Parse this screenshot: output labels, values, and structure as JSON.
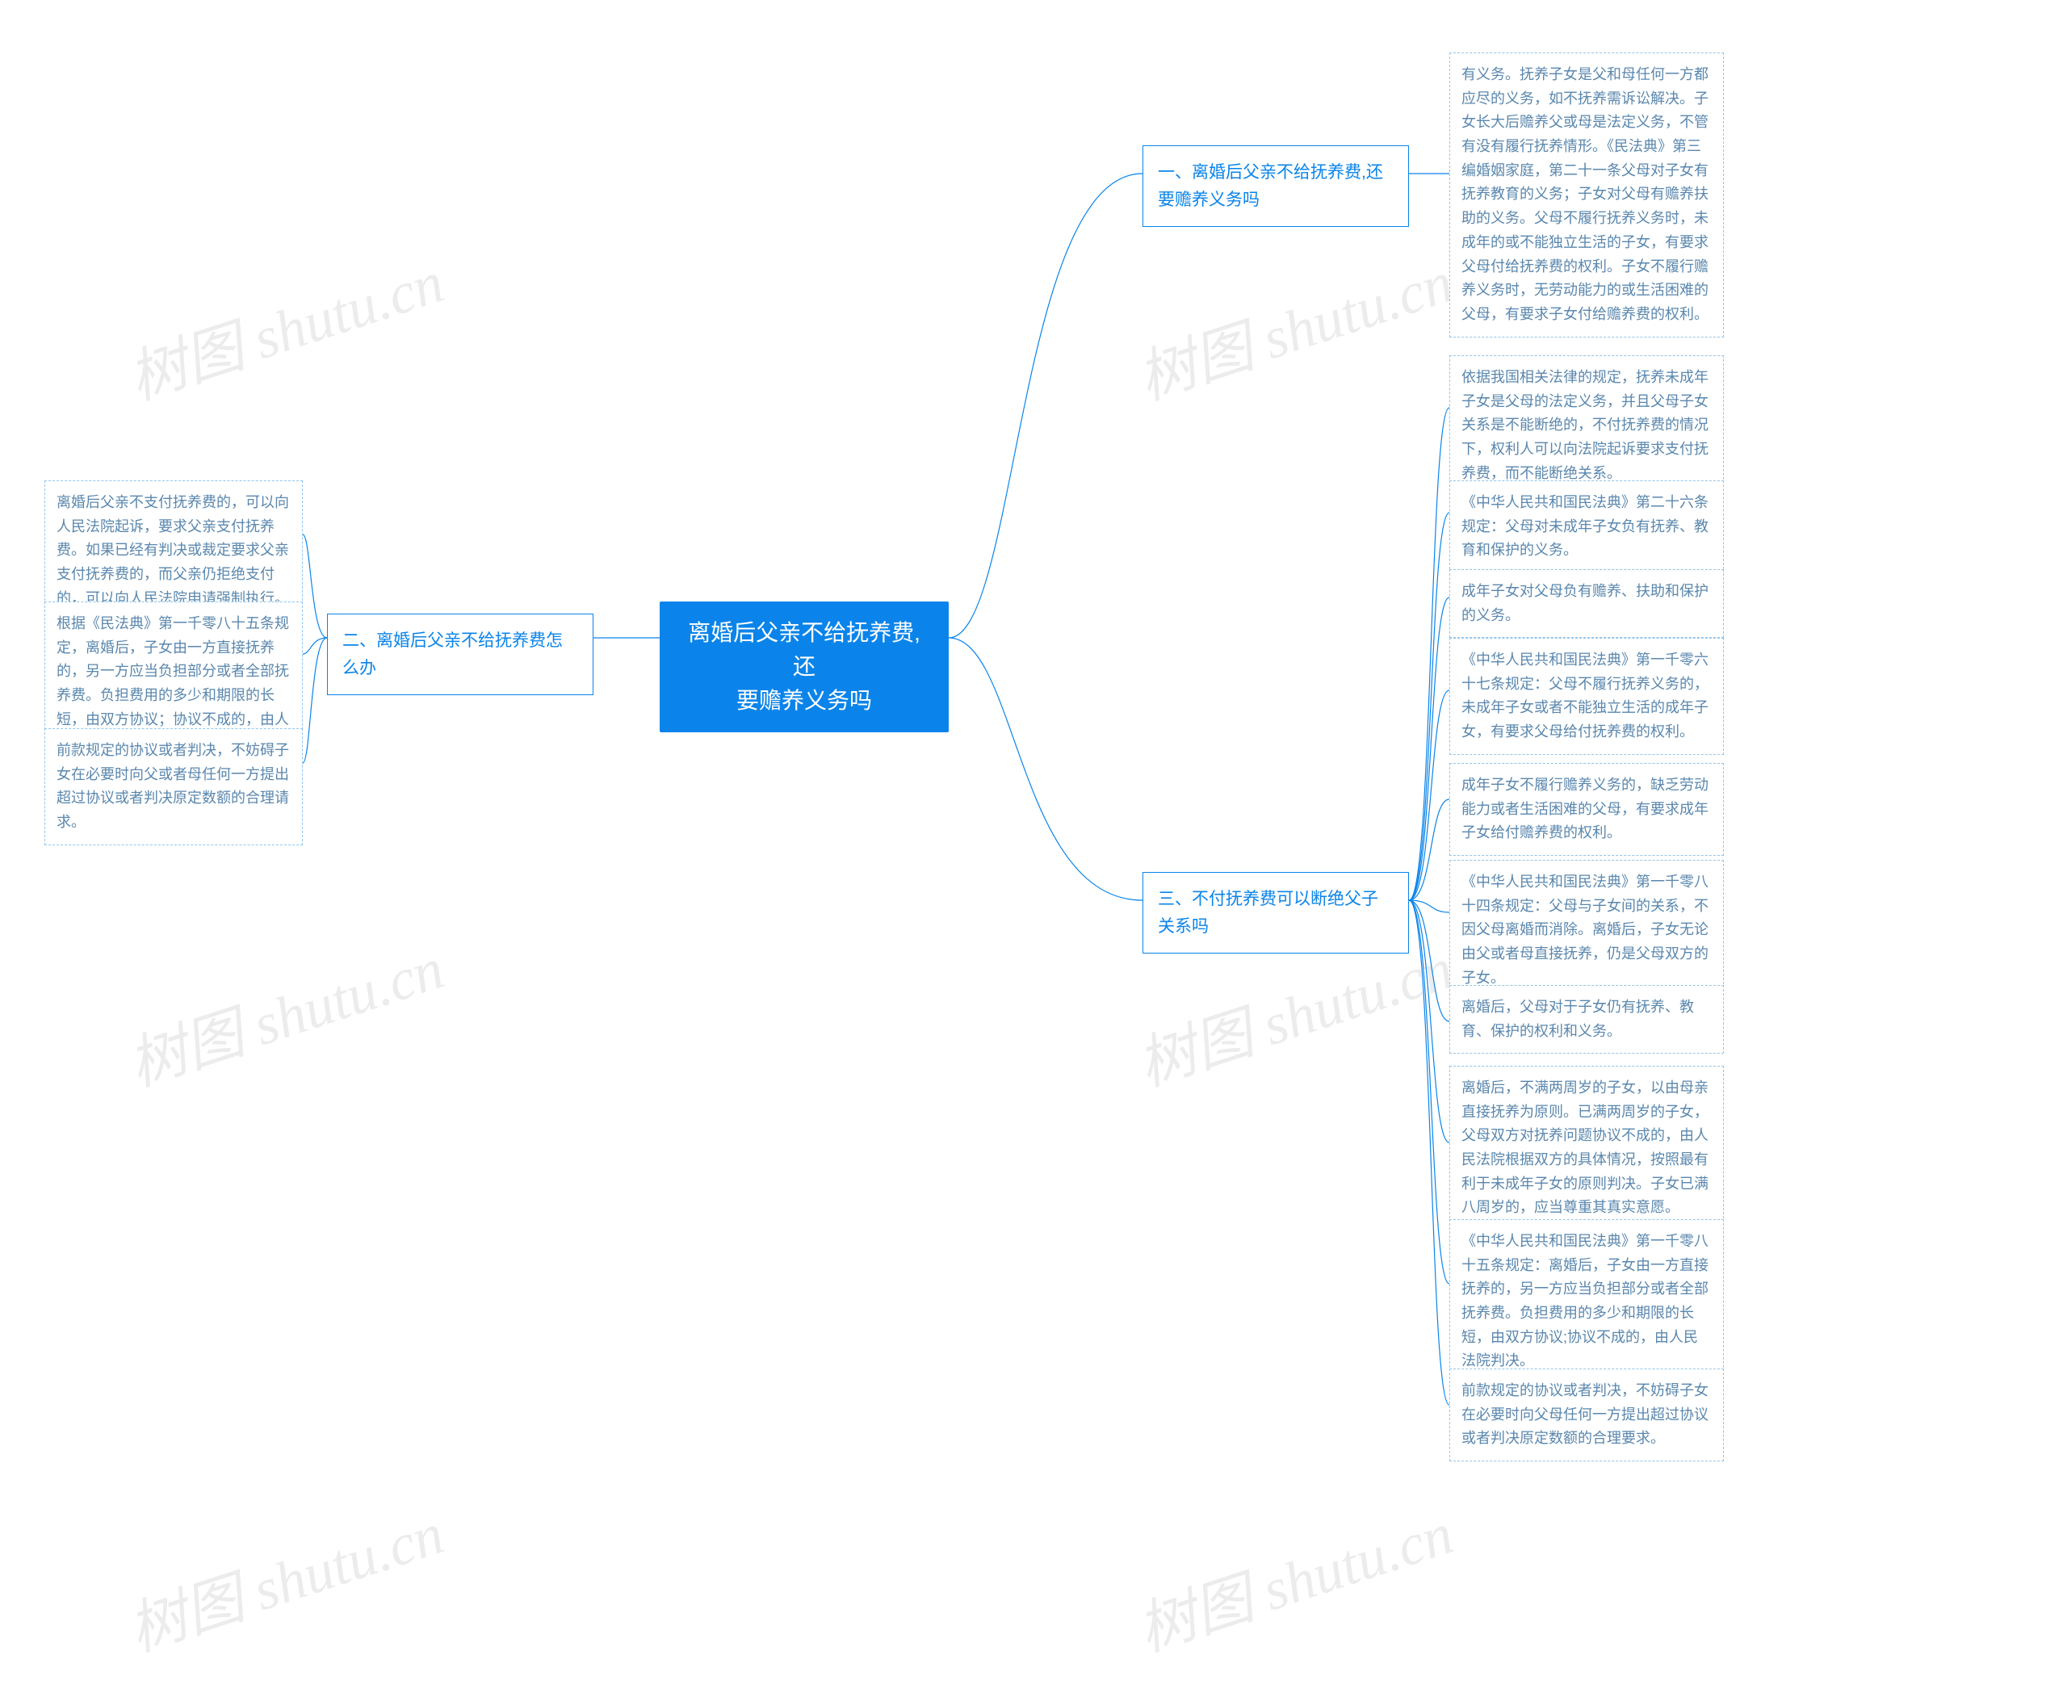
{
  "center": {
    "title_line1": "离婚后父亲不给抚养费,还",
    "title_line2": "要赡养义务吗"
  },
  "left": {
    "branch2": {
      "title": "二、离婚后父亲不给抚养费怎么办",
      "items": [
        "离婚后父亲不支付抚养费的，可以向人民法院起诉，要求父亲支付抚养费。如果已经有判决或裁定要求父亲支付抚养费的，而父亲仍拒绝支付的，可以向人民法院申请强制执行。",
        "根据《民法典》第一千零八十五条规定，离婚后，子女由一方直接抚养的，另一方应当负担部分或者全部抚养费。负担费用的多少和期限的长短，由双方协议；协议不成的，由人民法院判决。",
        "前款规定的协议或者判决，不妨碍子女在必要时向父或者母任何一方提出超过协议或者判决原定数额的合理请求。"
      ]
    }
  },
  "right": {
    "branch1": {
      "title": "一、离婚后父亲不给抚养费,还要赡养义务吗",
      "items": [
        "有义务。抚养子女是父和母任何一方都应尽的义务，如不抚养需诉讼解决。子女长大后赡养父或母是法定义务，不管有没有履行抚养情形。《民法典》第三编婚姻家庭，第二十一条父母对子女有抚养教育的义务；子女对父母有赡养扶助的义务。父母不履行抚养义务时，未成年的或不能独立生活的子女，有要求父母付给抚养费的权利。子女不履行赡养义务时，无劳动能力的或生活困难的父母，有要求子女付给赡养费的权利。"
      ]
    },
    "branch3": {
      "title": "三、不付抚养费可以断绝父子关系吗",
      "items": [
        "依据我国相关法律的规定，抚养未成年子女是父母的法定义务，并且父母子女关系是不能断绝的，不付抚养费的情况下，权利人可以向法院起诉要求支付抚养费，而不能断绝关系。",
        "《中华人民共和国民法典》第二十六条规定：父母对未成年子女负有抚养、教育和保护的义务。",
        "成年子女对父母负有赡养、扶助和保护的义务。",
        "《中华人民共和国民法典》第一千零六十七条规定：父母不履行抚养义务的，未成年子女或者不能独立生活的成年子女，有要求父母给付抚养费的权利。",
        "成年子女不履行赡养义务的，缺乏劳动能力或者生活困难的父母，有要求成年子女给付赡养费的权利。",
        "《中华人民共和国民法典》第一千零八十四条规定：父母与子女间的关系，不因父母离婚而消除。离婚后，子女无论由父或者母直接抚养，仍是父母双方的子女。",
        "离婚后，父母对于子女仍有抚养、教育、保护的权利和义务。",
        "离婚后，不满两周岁的子女，以由母亲直接抚养为原则。已满两周岁的子女，父母双方对抚养问题协议不成的，由人民法院根据双方的具体情况，按照最有利于未成年子女的原则判决。子女已满八周岁的，应当尊重其真实意愿。",
        "《中华人民共和国民法典》第一千零八十五条规定：离婚后，子女由一方直接抚养的，另一方应当负担部分或者全部抚养费。负担费用的多少和期限的长短，由双方协议;协议不成的，由人民法院判决。",
        "前款规定的协议或者判决，不妨碍子女在必要时向父母任何一方提出超过协议或者判决原定数额的合理要求。"
      ]
    }
  },
  "watermark": "树图 shutu.cn"
}
